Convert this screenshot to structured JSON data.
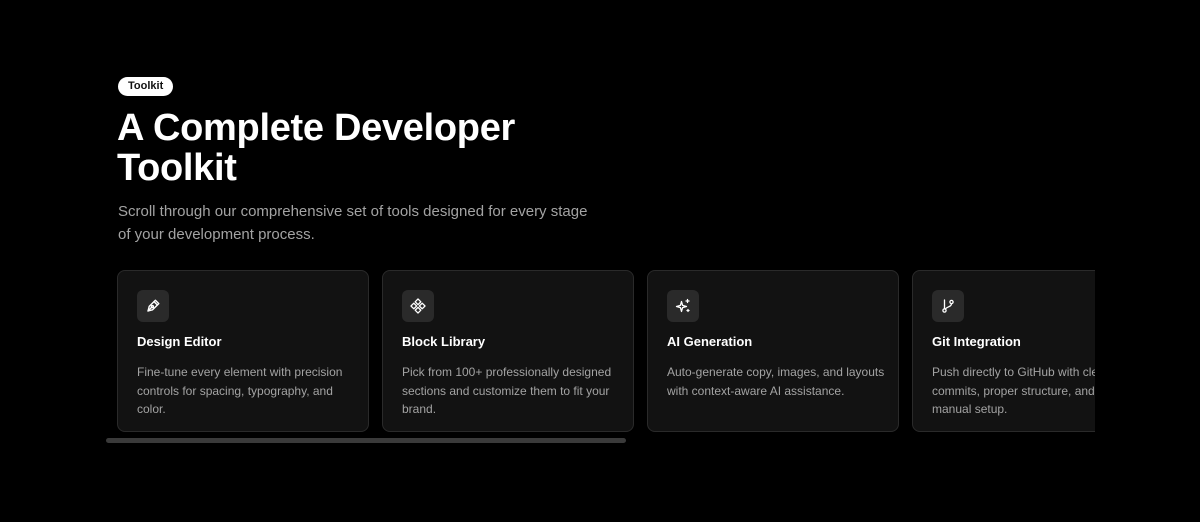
{
  "badge": "Toolkit",
  "heading": {
    "line1": "A Complete Developer",
    "line2": "Toolkit"
  },
  "subtitle": "Scroll through our comprehensive set of tools designed for every stage of your development process.",
  "cards": [
    {
      "icon": "pen-tool-icon",
      "title": "Design Editor",
      "description": "Fine-tune every element with precision controls for spacing, typography, and color."
    },
    {
      "icon": "blocks-icon",
      "title": "Block Library",
      "description": "Pick from 100+ professionally designed sections and customize them to fit your brand."
    },
    {
      "icon": "sparkles-icon",
      "title": "AI Generation",
      "description": "Auto-generate copy, images, and layouts with context-aware AI assistance."
    },
    {
      "icon": "git-branch-icon",
      "title": "Git Integration",
      "description": "Push directly to GitHub with clean commits, proper structure, and no manual setup."
    }
  ],
  "colors": {
    "background": "#000000",
    "card_background": "#121212",
    "card_border": "#2a2a2a",
    "muted_text": "#a3a3a3",
    "badge_background": "#ffffff"
  }
}
